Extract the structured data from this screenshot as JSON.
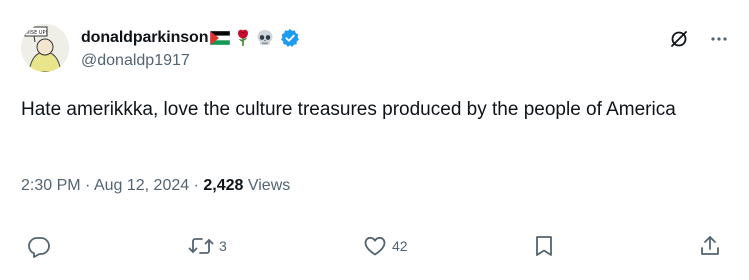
{
  "author": {
    "display_name": "donaldparkinson",
    "handle": "@donaldp1917",
    "badges": [
      "palestine-flag-icon",
      "rose-icon",
      "skull-icon",
      "verified-badge-icon"
    ],
    "avatar_sign_text": "WISE UP!"
  },
  "tweet": {
    "text": "Hate amerikkka, love the culture treasures produced by the people of America",
    "time": "2:30 PM",
    "sep1": " · ",
    "date": "Aug 12, 2024",
    "sep2": " · ",
    "views_count": "2,428",
    "views_label": " Views"
  },
  "actions": {
    "reply_count": "",
    "retweet_count": "3",
    "like_count": "42"
  },
  "colors": {
    "text": "#0f1419",
    "secondary": "#536471",
    "verified": "#1d9bf0"
  }
}
